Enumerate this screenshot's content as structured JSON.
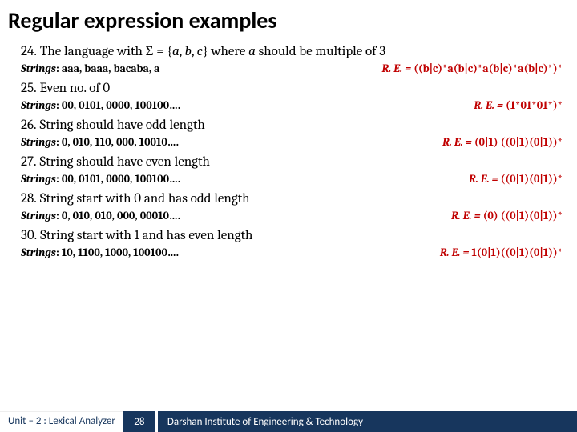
{
  "title": "Regular expression examples",
  "items": [
    {
      "num": "24.",
      "problem_html": "The language with Σ = {<i>a</i>, <i>b</i>, <i>c</i>} where <i>a</i> should be multiple of 3",
      "strings_label": "Strings",
      "strings": ": aaa, baaa, bacaba, a",
      "re_label": "R. E. = ",
      "re": "((b|c)*a(b|c)*a(b|c)*a(b|c)*)*"
    },
    {
      "num": "25.",
      "problem_html": "Even no. of 0",
      "strings_label": "Strings",
      "strings": ": 00, 0101, 0000, 100100….",
      "re_label": "R. E. = ",
      "re": "(1*01*01*)*"
    },
    {
      "num": "26.",
      "problem_html": "String should have odd length",
      "strings_label": "Strings",
      "strings": ": 0, 010, 110, 000, 10010….",
      "re_label": "R. E. = ",
      "re": "(0|1) ((0|1)(0|1))*"
    },
    {
      "num": "27.",
      "problem_html": "String should have even length",
      "strings_label": "Strings",
      "strings": ": 00, 0101, 0000, 100100….",
      "re_label": "R. E. = ",
      "re": "((0|1)(0|1))*"
    },
    {
      "num": "28.",
      "problem_html": "String start with 0 and has odd length",
      "strings_label": "Strings",
      "strings": ": 0, 010, 010, 000, 00010….",
      "re_label": "R. E. = ",
      "re": "(0) ((0|1)(0|1))*"
    },
    {
      "num": "30.",
      "problem_html": "String start with 1 and has even length",
      "strings_label": "Strings",
      "strings": ": 10, 1100, 1000, 100100….",
      "re_label": "R. E. = ",
      "re": "1(0|1)((0|1)(0|1))*"
    }
  ],
  "footer": {
    "unit": "Unit – 2  : Lexical Analyzer",
    "page": "28",
    "org": "Darshan Institute of Engineering & Technology"
  }
}
